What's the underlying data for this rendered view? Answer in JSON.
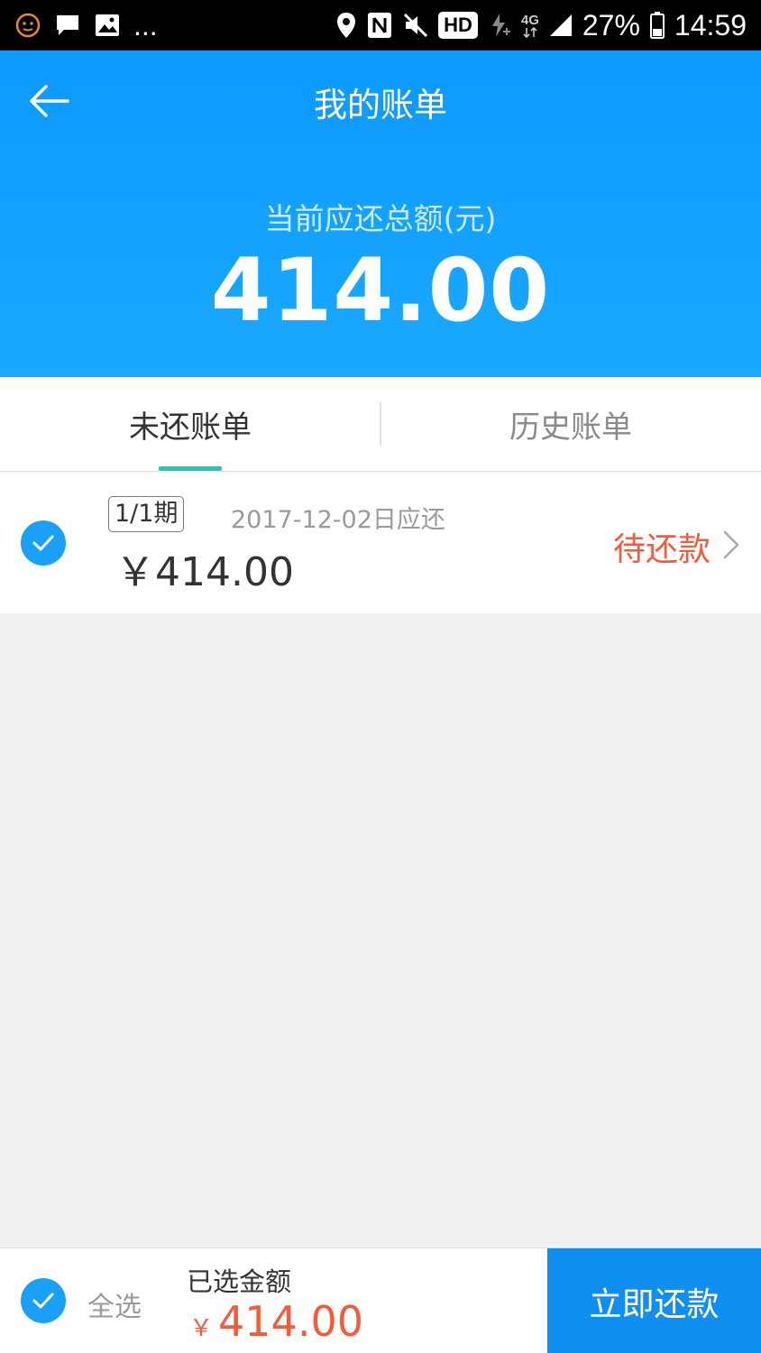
{
  "status_bar": {
    "left_icons": [
      "face-icon",
      "chat-icon",
      "image-icon"
    ],
    "more": "...",
    "hd": "HD",
    "network": "4G",
    "battery": "27%",
    "time": "14:59"
  },
  "header": {
    "title": "我的账单",
    "total_label": "当前应还总额(元)",
    "total_amount": "414.00"
  },
  "tabs": [
    {
      "label": "未还账单",
      "active": true
    },
    {
      "label": "历史账单",
      "active": false
    }
  ],
  "bills": [
    {
      "period": "1/1期",
      "due": "2017-12-02日应还",
      "amount": "￥414.00",
      "status": "待还款",
      "checked": true
    }
  ],
  "bottom_bar": {
    "select_all": "全选",
    "selected_label": "已选金额",
    "currency": "￥",
    "selected_amount": "414.00",
    "pay_button": "立即还款"
  },
  "colors": {
    "header_blue": "#0e99ff",
    "accent_green": "#20c9b4",
    "status_red": "#f45b3c",
    "pay_blue": "#118ff0"
  }
}
